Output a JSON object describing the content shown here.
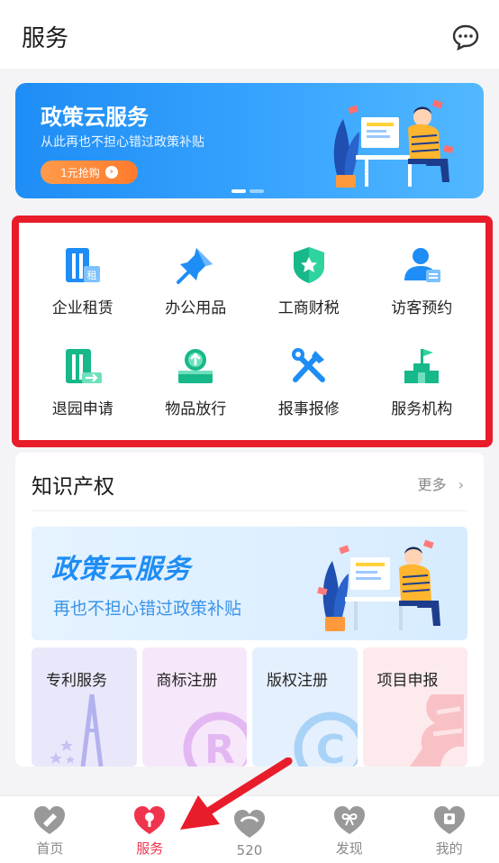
{
  "header": {
    "title": "服务",
    "message_icon": "chat-bubble-icon"
  },
  "banner": {
    "title": "政策云服务",
    "subtitle": "从此再也不担心错过政策补贴",
    "button_label": "1元抢购",
    "button_icon": "arrow-right-circle-icon"
  },
  "services": [
    {
      "label": "企业租赁",
      "icon": "building-rent-icon",
      "color": "#1e8df5"
    },
    {
      "label": "办公用品",
      "icon": "pushpin-icon",
      "color": "#1e8df5"
    },
    {
      "label": "工商财税",
      "icon": "shield-star-icon",
      "color": "#17b88a"
    },
    {
      "label": "访客预约",
      "icon": "visitor-card-icon",
      "color": "#1e8df5"
    },
    {
      "label": "退园申请",
      "icon": "exit-building-icon",
      "color": "#17b88a"
    },
    {
      "label": "物品放行",
      "icon": "box-upload-icon",
      "color": "#17b88a"
    },
    {
      "label": "报事报修",
      "icon": "tools-repair-icon",
      "color": "#1e8df5"
    },
    {
      "label": "服务机构",
      "icon": "flag-building-icon",
      "color": "#17b88a"
    }
  ],
  "ip_section": {
    "title": "知识产权",
    "more_label": "更多",
    "ad_title": "政策云服务",
    "ad_subtitle": "再也不担心错过政策补贴",
    "cards": [
      {
        "label": "专利服务",
        "icon": "patent-tower-icon"
      },
      {
        "label": "商标注册",
        "icon": "registered-mark-icon"
      },
      {
        "label": "版权注册",
        "icon": "copyright-icon"
      },
      {
        "label": "项目申报",
        "icon": "document-stamp-icon"
      }
    ]
  },
  "tabbar": [
    {
      "label": "首页",
      "icon": "home-heart-icon",
      "active": false
    },
    {
      "label": "服务",
      "icon": "service-heart-icon",
      "active": true
    },
    {
      "label": "520",
      "icon": "heart-520-icon",
      "active": false
    },
    {
      "label": "发现",
      "icon": "discover-heart-icon",
      "active": false
    },
    {
      "label": "我的",
      "icon": "profile-heart-icon",
      "active": false
    }
  ],
  "colors": {
    "accent": "#f0344e",
    "highlight_border": "#e81c2a",
    "blue": "#1e8df5",
    "green": "#17b88a"
  }
}
